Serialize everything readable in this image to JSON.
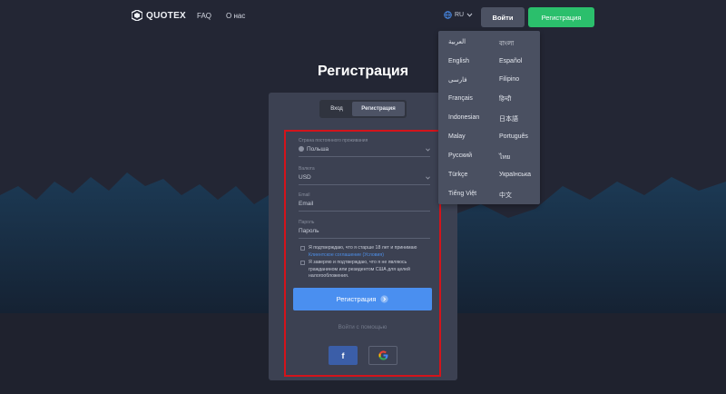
{
  "header": {
    "logo_text": "QUOTEX",
    "nav": [
      "FAQ",
      "О нас"
    ],
    "lang_label": "RU",
    "login_label": "Войти",
    "register_label": "Регистрация"
  },
  "lang_menu": {
    "left": [
      "العربية",
      "English",
      "فارسی",
      "Français",
      "Indonesian",
      "Malay",
      "Русский",
      "Türkçe",
      "Tiếng Việt"
    ],
    "right": [
      "বাংলা",
      "Español",
      "Filipino",
      "हिन्दी",
      "日本語",
      "Português",
      "ไทย",
      "Українська",
      "中文"
    ]
  },
  "page": {
    "title": "Регистрация"
  },
  "form": {
    "tabs": [
      "Вход",
      "Регистрация"
    ],
    "country_label": "Страна постоянного проживания",
    "country_value": "Польша",
    "currency_label": "Валюта",
    "currency_value": "USD",
    "email_label": "Email",
    "email_value": "Email",
    "password_label": "Пароль",
    "password_value": "Пароль",
    "check1_text": "Я подтверждаю, что я старше 18 лет и принимаю",
    "check1_link": "Клиентское соглашение (Условия)",
    "check2_text": "Я заверяю и подтверждаю, что я не являюсь гражданином или резидентом США для целей налогообложения.",
    "submit_label": "Регистрация",
    "or_text": "Войти с помощью",
    "facebook_label": "f"
  },
  "colors": {
    "accent_blue": "#4a8ff0",
    "register_green": "#2bbf6c",
    "highlight_red": "#d3141b"
  }
}
